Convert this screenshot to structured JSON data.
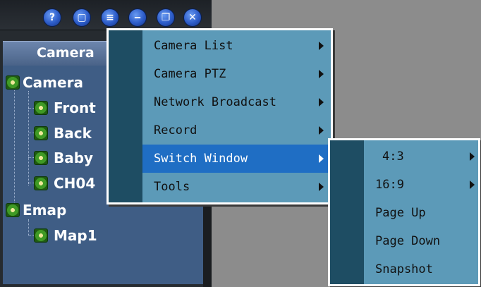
{
  "window": {
    "title_buttons": [
      {
        "name": "help-button",
        "glyph": "?"
      },
      {
        "name": "lock-button",
        "glyph": "▢"
      },
      {
        "name": "document-button",
        "glyph": "≡"
      },
      {
        "name": "minimize-button",
        "glyph": "‒"
      },
      {
        "name": "restore-button",
        "glyph": "❐"
      },
      {
        "name": "close-button",
        "glyph": "✕"
      }
    ]
  },
  "panel": {
    "header": "Camera"
  },
  "tree": {
    "items": [
      {
        "label": "Camera",
        "level": 0
      },
      {
        "label": "Front",
        "level": 1
      },
      {
        "label": "Back",
        "level": 1
      },
      {
        "label": "Baby",
        "level": 1
      },
      {
        "label": "CH04",
        "level": 1
      },
      {
        "label": "Emap",
        "level": 0
      },
      {
        "label": "Map1",
        "level": 1
      }
    ]
  },
  "context_menu": {
    "items": [
      {
        "label": "Camera List",
        "submenu": true
      },
      {
        "label": "Camera PTZ",
        "submenu": true
      },
      {
        "label": "Network Broadcast",
        "submenu": true
      },
      {
        "label": "Record",
        "submenu": true
      },
      {
        "label": "Switch Window",
        "submenu": true,
        "active": true
      },
      {
        "label": "Tools",
        "submenu": true
      }
    ],
    "highlight_color": "#1f6ec4",
    "background_color": "#5c9ab8"
  },
  "sub_menu": {
    "items": [
      {
        "label": "4:3",
        "submenu": true
      },
      {
        "label": "16:9",
        "submenu": true
      },
      {
        "label": "Page Up",
        "submenu": false
      },
      {
        "label": "Page Down",
        "submenu": false
      },
      {
        "label": "Snapshot",
        "submenu": false
      }
    ]
  }
}
